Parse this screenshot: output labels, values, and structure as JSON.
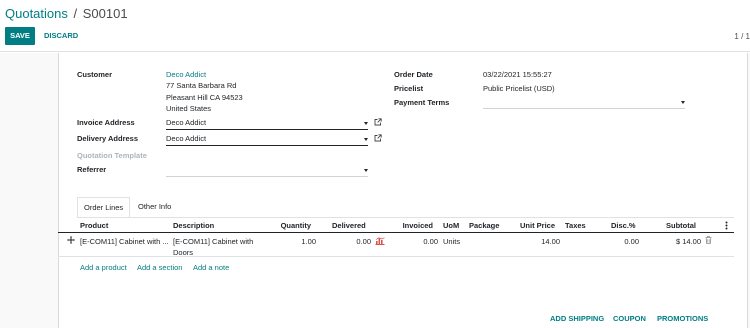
{
  "breadcrumb": {
    "parent": "Quotations",
    "separator": "/",
    "current": "S00101"
  },
  "toolbar": {
    "save_label": "SAVE",
    "discard_label": "DISCARD",
    "pager": "1 / 1"
  },
  "form": {
    "customer": {
      "label": "Customer",
      "name": "Deco Addict",
      "address_line1": "77 Santa Barbara Rd",
      "address_line2": "Pleasant Hill CA 94523",
      "country": "United States"
    },
    "invoice_address": {
      "label": "Invoice Address",
      "value": "Deco Addict"
    },
    "delivery_address": {
      "label": "Delivery Address",
      "value": "Deco Addict"
    },
    "quotation_template": {
      "label": "Quotation Template"
    },
    "referrer": {
      "label": "Referrer",
      "value": ""
    },
    "order_date": {
      "label": "Order Date",
      "value": "03/22/2021 15:55:27"
    },
    "pricelist": {
      "label": "Pricelist",
      "value": "Public Pricelist (USD)"
    },
    "payment_terms": {
      "label": "Payment Terms",
      "value": ""
    }
  },
  "tabs": [
    {
      "label": "Order Lines"
    },
    {
      "label": "Other Info"
    }
  ],
  "table": {
    "columns": [
      "Product",
      "Description",
      "Quantity",
      "Delivered",
      "Invoiced",
      "UoM",
      "Package",
      "Unit Price",
      "Taxes",
      "Disc.%",
      "Subtotal"
    ],
    "rows": [
      {
        "product": "[E-COM11] Cabinet with ...",
        "description_line1": "[E-COM11] Cabinet with",
        "description_line2": "Doors",
        "quantity": "1.00",
        "delivered": "0.00",
        "invoiced": "0.00",
        "uom": "Units",
        "package": "",
        "unit_price": "14.00",
        "taxes": "",
        "discount": "0.00",
        "subtotal": "$ 14.00"
      }
    ],
    "add_product": "Add a product",
    "add_section": "Add a section",
    "add_note": "Add a note"
  },
  "footer": {
    "add_shipping": "ADD SHIPPING",
    "coupon": "COUPON",
    "promotions": "PROMOTIONS"
  },
  "colors": {
    "brand": "#017e84",
    "forecast_icon": "#d9534f"
  },
  "icons": [
    "external-link-icon",
    "drag-handle-icon",
    "forecast-chart-icon",
    "trash-icon",
    "options-kebab-icon",
    "dropdown-caret-icon"
  ]
}
